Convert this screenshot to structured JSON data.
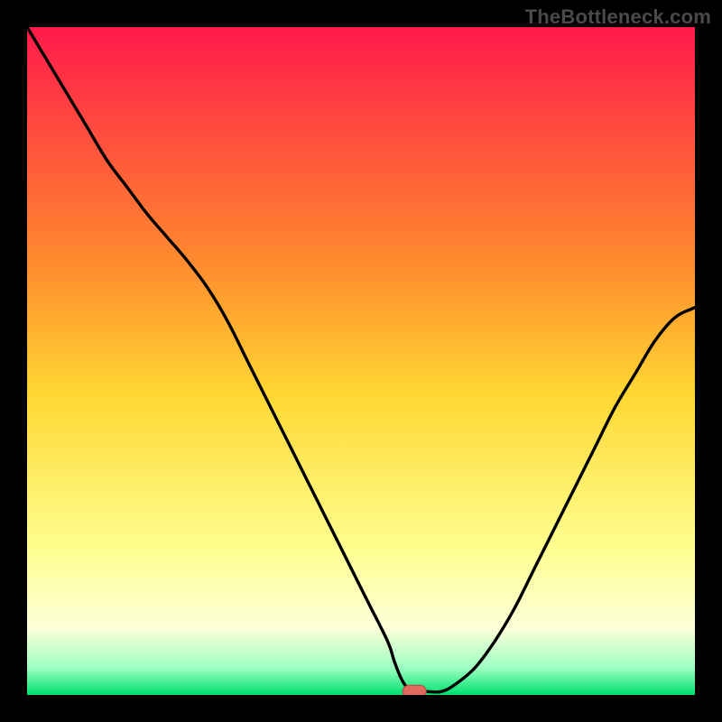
{
  "watermark": "TheBottleneck.com",
  "colors": {
    "frame": "#000000",
    "gradient_top": "#ff1a4b",
    "gradient_upper_mid": "#ff8a2e",
    "gradient_mid": "#ffd733",
    "gradient_lower_mid": "#ffff8f",
    "gradient_low": "#fdffd9",
    "gradient_bottom1": "#9bffc2",
    "gradient_bottom2": "#00e06e",
    "curve": "#000000",
    "marker_fill": "#e2695e",
    "marker_stroke": "#b34f46"
  },
  "chart_data": {
    "type": "line",
    "title": "",
    "xlabel": "",
    "ylabel": "",
    "xlim": [
      0,
      100
    ],
    "ylim": [
      0,
      100
    ],
    "grid": false,
    "legend": false,
    "annotations": [],
    "series": [
      {
        "name": "bottleneck-curve",
        "x": [
          0,
          3,
          6,
          9,
          12,
          15,
          18,
          21,
          24,
          27,
          30,
          33,
          36,
          39,
          42,
          45,
          48,
          51,
          54,
          55,
          56,
          57,
          58,
          59,
          60,
          62,
          64,
          67,
          70,
          73,
          76,
          79,
          82,
          85,
          88,
          91,
          94,
          97,
          100
        ],
        "y": [
          100,
          95,
          90,
          85,
          80,
          76,
          72,
          68.5,
          65,
          61,
          56,
          50,
          44,
          38,
          32,
          26,
          20,
          14,
          8,
          5,
          2.5,
          1,
          0.5,
          0.5,
          0.5,
          0.5,
          1.5,
          4,
          8,
          13,
          19,
          25,
          31,
          37,
          43,
          48,
          53,
          56.5,
          58
        ]
      },
      {
        "name": "flat-minimum",
        "x": [
          54,
          62
        ],
        "y": [
          0.5,
          0.5
        ]
      }
    ],
    "marker": {
      "name": "optimal-point",
      "x": 58,
      "y": 0.5,
      "shape": "rounded-rect"
    }
  }
}
